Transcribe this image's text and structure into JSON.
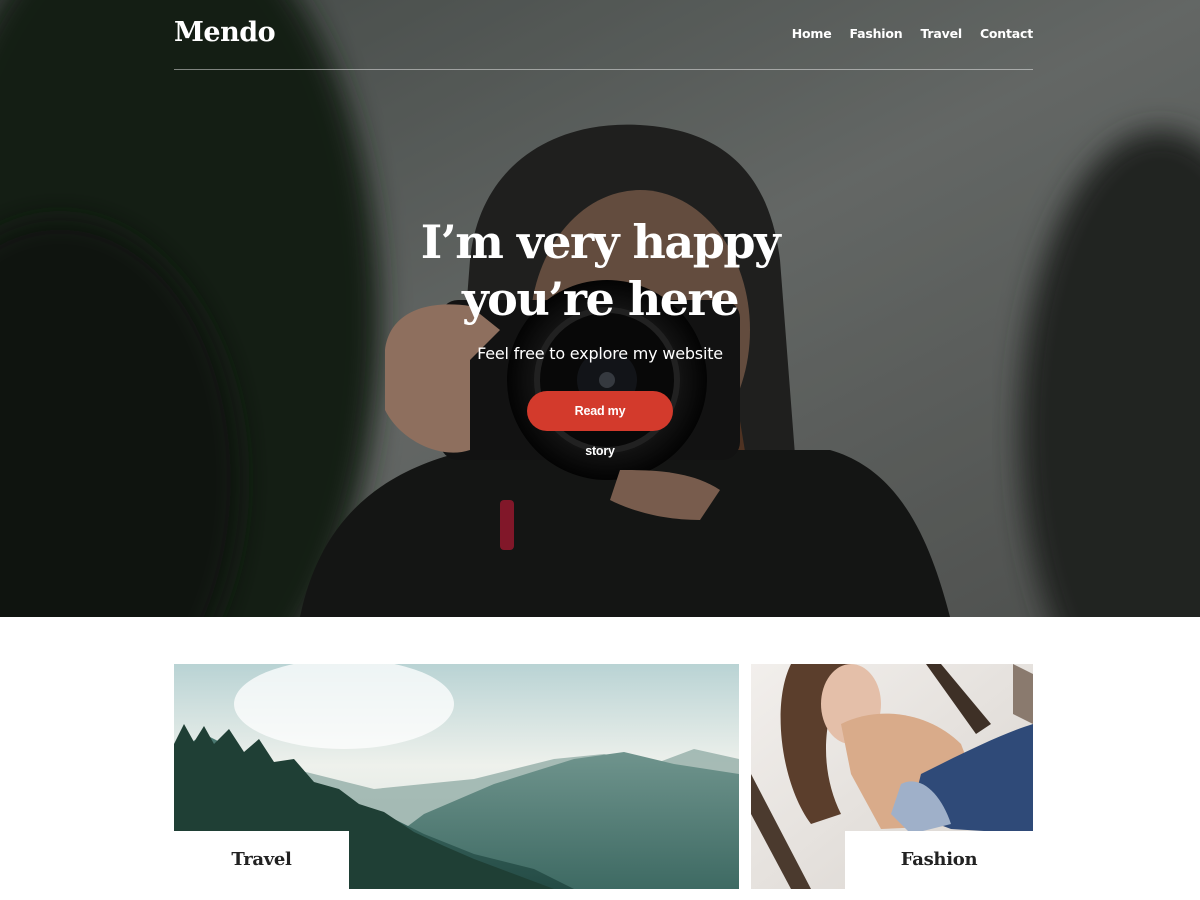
{
  "site": {
    "title": "Mendo"
  },
  "nav": {
    "items": [
      {
        "label": "Home"
      },
      {
        "label": "Fashion"
      },
      {
        "label": "Travel"
      },
      {
        "label": "Contact"
      }
    ]
  },
  "hero": {
    "heading": "I’m very happy you’re here",
    "subheading": "Feel free to explore my website",
    "button_label": "Read my story"
  },
  "cards": [
    {
      "label": "Travel"
    },
    {
      "label": "Fashion"
    }
  ],
  "colors": {
    "accent": "#d33a2c",
    "text_dark": "#222222",
    "white": "#ffffff"
  }
}
